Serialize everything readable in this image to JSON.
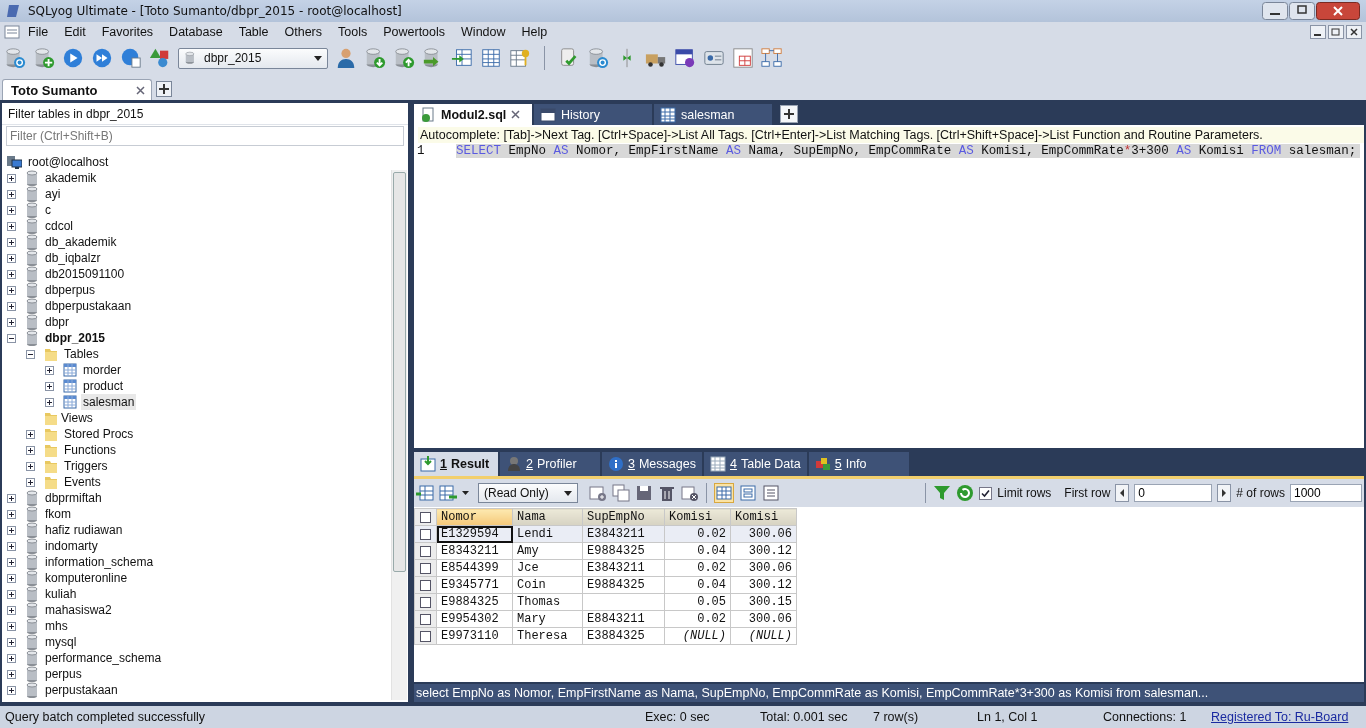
{
  "window": {
    "title": "SQLyog Ultimate - [Toto Sumanto/dbpr_2015 - root@localhost]"
  },
  "menu": [
    "File",
    "Edit",
    "Favorites",
    "Database",
    "Table",
    "Others",
    "Tools",
    "Powertools",
    "Window",
    "Help"
  ],
  "database_selector": {
    "value": "dbpr_2015"
  },
  "connection_tabs": [
    {
      "label": "Toto Sumanto",
      "selected": true
    }
  ],
  "object_browser": {
    "title": "Filter tables in dbpr_2015",
    "filter": {
      "placeholder": "Filter (Ctrl+Shift+B)"
    },
    "tree": [
      {
        "label": "root@localhost",
        "kind": "server",
        "selected": false,
        "current": false,
        "children": [
          {
            "label": "akademik",
            "kind": "database",
            "expanded": false,
            "selected": false,
            "current": false
          },
          {
            "label": "ayi",
            "kind": "database",
            "expanded": false,
            "selected": false,
            "current": false
          },
          {
            "label": "c",
            "kind": "database",
            "expanded": false,
            "selected": false,
            "current": false
          },
          {
            "label": "cdcol",
            "kind": "database",
            "expanded": false,
            "selected": false,
            "current": false
          },
          {
            "label": "db_akademik",
            "kind": "database",
            "expanded": false,
            "selected": false,
            "current": false
          },
          {
            "label": "db_iqbalzr",
            "kind": "database",
            "expanded": false,
            "selected": false,
            "current": false
          },
          {
            "label": "db2015091100",
            "kind": "database",
            "expanded": false,
            "selected": false,
            "current": false
          },
          {
            "label": "dbperpus",
            "kind": "database",
            "expanded": false,
            "selected": false,
            "current": false
          },
          {
            "label": "dbperpustakaan",
            "kind": "database",
            "expanded": false,
            "selected": false,
            "current": false
          },
          {
            "label": "dbpr",
            "kind": "database",
            "expanded": false,
            "selected": false,
            "current": false
          },
          {
            "label": "dbpr_2015",
            "kind": "database",
            "expanded": true,
            "selected": false,
            "current": true,
            "children": [
              {
                "label": "Tables",
                "kind": "folder",
                "expanded": true,
                "selected": false,
                "current": false,
                "children": [
                  {
                    "label": "morder",
                    "kind": "table",
                    "expanded": false,
                    "selected": false,
                    "current": false
                  },
                  {
                    "label": "product",
                    "kind": "table",
                    "expanded": false,
                    "selected": false,
                    "current": false
                  },
                  {
                    "label": "salesman",
                    "kind": "table",
                    "expanded": false,
                    "selected": true,
                    "current": false
                  }
                ]
              },
              {
                "label": "Views",
                "kind": "folder",
                "selected": false,
                "current": false
              },
              {
                "label": "Stored Procs",
                "kind": "folder",
                "expanded": false,
                "selected": false,
                "current": false
              },
              {
                "label": "Functions",
                "kind": "folder",
                "expanded": false,
                "selected": false,
                "current": false
              },
              {
                "label": "Triggers",
                "kind": "folder",
                "expanded": false,
                "selected": false,
                "current": false
              },
              {
                "label": "Events",
                "kind": "folder",
                "expanded": false,
                "selected": false,
                "current": false
              }
            ]
          },
          {
            "label": "dbprmiftah",
            "kind": "database",
            "expanded": false,
            "selected": false,
            "current": false
          },
          {
            "label": "fkom",
            "kind": "database",
            "expanded": false,
            "selected": false,
            "current": false
          },
          {
            "label": "hafiz rudiawan",
            "kind": "database",
            "expanded": false,
            "selected": false,
            "current": false
          },
          {
            "label": "indomarty",
            "kind": "database",
            "expanded": false,
            "selected": false,
            "current": false
          },
          {
            "label": "information_schema",
            "kind": "database",
            "expanded": false,
            "selected": false,
            "current": false
          },
          {
            "label": "komputeronline",
            "kind": "database",
            "expanded": false,
            "selected": false,
            "current": false
          },
          {
            "label": "kuliah",
            "kind": "database",
            "expanded": false,
            "selected": false,
            "current": false
          },
          {
            "label": "mahasiswa2",
            "kind": "database",
            "expanded": false,
            "selected": false,
            "current": false
          },
          {
            "label": "mhs",
            "kind": "database",
            "expanded": false,
            "selected": false,
            "current": false
          },
          {
            "label": "mysql",
            "kind": "database",
            "expanded": false,
            "selected": false,
            "current": false
          },
          {
            "label": "performance_schema",
            "kind": "database",
            "expanded": false,
            "selected": false,
            "current": false
          },
          {
            "label": "perpus",
            "kind": "database",
            "expanded": false,
            "selected": false,
            "current": false
          },
          {
            "label": "perpustakaan",
            "kind": "database",
            "expanded": false,
            "selected": false,
            "current": false
          }
        ]
      }
    ]
  },
  "editor_tabs": [
    {
      "label": "Modul2.sql",
      "kind": "query",
      "selected": true
    },
    {
      "label": "History",
      "kind": "history",
      "selected": false
    },
    {
      "label": "salesman",
      "kind": "table",
      "selected": false
    }
  ],
  "editor": {
    "autocomplete_hint": "Autocomplete: [Tab]->Next Tag. [Ctrl+Space]->List All Tags. [Ctrl+Enter]->List Matching Tags. [Ctrl+Shift+Space]->List Function and Routine Parameters.",
    "lines": [
      {
        "number": "1",
        "selected": true,
        "tokens": [
          {
            "text": "SELECT",
            "kind": "keyword"
          },
          {
            "text": " EmpNo ",
            "kind": "plain"
          },
          {
            "text": "AS",
            "kind": "keyword"
          },
          {
            "text": " Nomor, EmpFirstName ",
            "kind": "plain"
          },
          {
            "text": "AS",
            "kind": "keyword"
          },
          {
            "text": " Nama, SupEmpNo, EmpCommRate ",
            "kind": "plain"
          },
          {
            "text": "AS",
            "kind": "keyword"
          },
          {
            "text": " Komisi, EmpCommRate",
            "kind": "plain"
          },
          {
            "text": "*",
            "kind": "operator"
          },
          {
            "text": "3+300 ",
            "kind": "plain"
          },
          {
            "text": "AS",
            "kind": "keyword"
          },
          {
            "text": " Komisi ",
            "kind": "plain"
          },
          {
            "text": "FROM",
            "kind": "keyword"
          },
          {
            "text": " salesman;",
            "kind": "plain"
          }
        ]
      }
    ]
  },
  "result_tabs": [
    {
      "number": "1",
      "label": "Result",
      "kind": "result",
      "selected": true
    },
    {
      "number": "2",
      "label": "Profiler",
      "kind": "profiler",
      "selected": false
    },
    {
      "number": "3",
      "label": "Messages",
      "kind": "messages",
      "selected": false
    },
    {
      "number": "4",
      "label": "Table Data",
      "kind": "tabledata",
      "selected": false
    },
    {
      "number": "5",
      "label": "Info",
      "kind": "info",
      "selected": false
    }
  ],
  "result_toolbar": {
    "mode": {
      "value": "(Read Only)"
    },
    "limit_rows": {
      "label": "Limit rows",
      "checked": true
    },
    "first_row": {
      "label": "First row",
      "value": "0"
    },
    "row_count": {
      "label": "# of rows",
      "value": "1000"
    }
  },
  "grid": {
    "select_all": {
      "checked": false
    },
    "columns": [
      {
        "label": "Nomor",
        "kind": "text"
      },
      {
        "label": "Nama",
        "kind": "text"
      },
      {
        "label": "SupEmpNo",
        "kind": "text"
      },
      {
        "label": "Komisi",
        "kind": "number"
      },
      {
        "label": "Komisi",
        "kind": "number"
      }
    ],
    "rows": [
      {
        "selected": true,
        "checked": false,
        "cells": [
          "E1329594",
          "Lendi",
          "E3843211",
          "0.02",
          "300.06"
        ]
      },
      {
        "selected": false,
        "checked": false,
        "cells": [
          "E8343211",
          "Amy",
          "E9884325",
          "0.04",
          "300.12"
        ]
      },
      {
        "selected": false,
        "checked": false,
        "cells": [
          "E8544399",
          "Jce",
          "E3843211",
          "0.02",
          "300.06"
        ]
      },
      {
        "selected": false,
        "checked": false,
        "cells": [
          "E9345771",
          "Coin",
          "E9884325",
          "0.04",
          "300.12"
        ]
      },
      {
        "selected": false,
        "checked": false,
        "cells": [
          "E9884325",
          "Thomas",
          null,
          "0.05",
          "300.15"
        ]
      },
      {
        "selected": false,
        "checked": false,
        "cells": [
          "E9954302",
          "Mary",
          "E8843211",
          "0.02",
          "300.06"
        ]
      },
      {
        "selected": false,
        "checked": false,
        "cells": [
          "E9973110",
          "Theresa",
          "E3884325",
          {
            "text": "(NULL)",
            "kind": "null"
          },
          {
            "text": "(NULL)",
            "kind": "null"
          }
        ]
      }
    ]
  },
  "query_strip": "select EmpNo as Nomor, EmpFirstName as Nama, SupEmpNo, EmpCommRate as Komisi, EmpCommRate*3+300 as Komisi from salesman...",
  "status_bar": [
    {
      "text": "Query batch completed successfully",
      "kind": "message"
    },
    {
      "text": "Exec: 0 sec",
      "kind": "field"
    },
    {
      "text": "Total: 0.001 sec",
      "kind": "field"
    },
    {
      "text": "7 row(s)",
      "kind": "field"
    },
    {
      "text": "Ln 1, Col 1",
      "kind": "field"
    },
    {
      "text": "Connections: 1",
      "kind": "field"
    },
    {
      "text": "Registered To: Ru-Board",
      "kind": "link"
    }
  ]
}
